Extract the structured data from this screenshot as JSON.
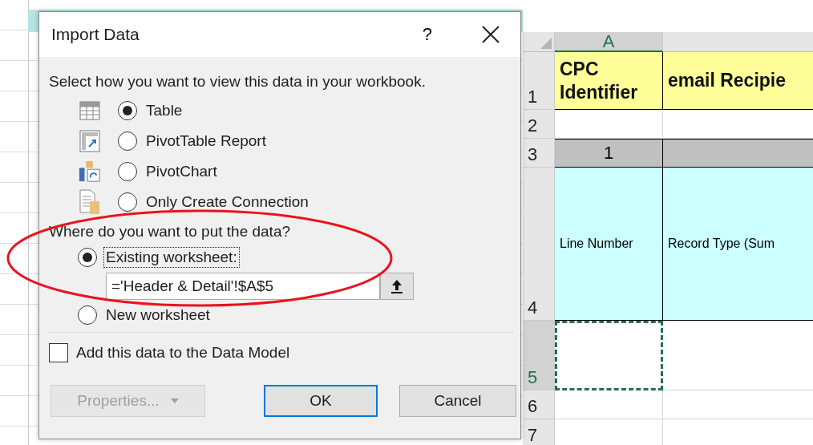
{
  "dialog": {
    "title": "Import Data",
    "help": "?",
    "intro": "Select how you want to view this data in your workbook.",
    "view_options": [
      {
        "kind": "table",
        "label": "Table",
        "selected": true
      },
      {
        "kind": "pivot-table",
        "label": "PivotTable Report",
        "selected": false
      },
      {
        "kind": "pivot-chart",
        "label": "PivotChart",
        "selected": false
      },
      {
        "kind": "connection",
        "label": "Only Create Connection",
        "selected": false
      }
    ],
    "location_heading": "Where do you want to put the data?",
    "location_options": [
      {
        "label": "Existing worksheet:",
        "selected": true,
        "focused": true,
        "range": "='Header & Detail'!$A$5"
      },
      {
        "label": "New worksheet",
        "selected": false,
        "focused": false
      }
    ],
    "data_model": {
      "label": "Add this data to the Data Model",
      "checked": false
    },
    "buttons": [
      {
        "label": "Properties...",
        "kind": "dropdown",
        "disabled": true,
        "default": false
      },
      {
        "label": "OK",
        "kind": "push",
        "disabled": false,
        "default": true
      },
      {
        "label": "Cancel",
        "kind": "push",
        "disabled": false,
        "default": false
      }
    ]
  },
  "sheet": {
    "columns": [
      {
        "label": "A",
        "selected": true
      },
      {
        "selected": false
      }
    ],
    "rows": [
      {
        "number": "1",
        "kind": "title",
        "selected": false,
        "cells": [
          {
            "text": "CPC Identifier"
          },
          {
            "text": "email Recipie"
          }
        ]
      },
      {
        "number": "2",
        "kind": "blank",
        "selected": false,
        "cells": [
          {},
          {}
        ]
      },
      {
        "number": "3",
        "kind": "band",
        "selected": false,
        "cells": [
          {
            "text": "1"
          },
          {}
        ]
      },
      {
        "number": "4",
        "kind": "labels",
        "selected": false,
        "cells": [
          {
            "text": "Line Number"
          },
          {
            "text": "Record Type (Sum"
          }
        ]
      },
      {
        "number": "5",
        "kind": "entry",
        "selected": true,
        "cells": [
          {
            "active": true
          },
          {
            "active": false
          }
        ]
      },
      {
        "number": "6",
        "kind": "blank",
        "selected": false,
        "cells": [
          {},
          {}
        ]
      },
      {
        "number": "7",
        "kind": "blank",
        "selected": false,
        "cells": [
          {},
          {}
        ]
      }
    ]
  }
}
